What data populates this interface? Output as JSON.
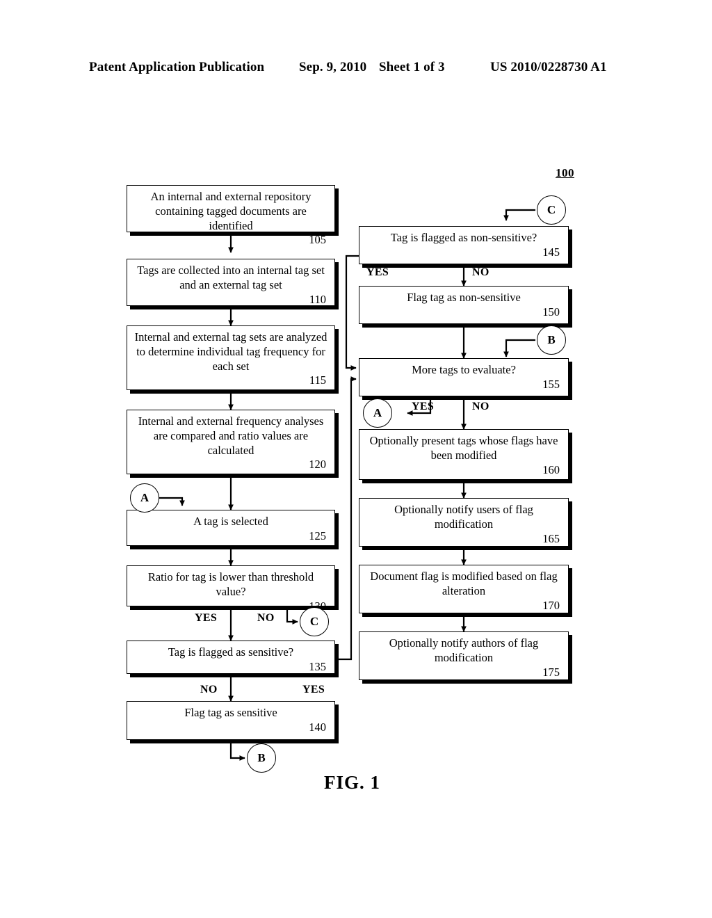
{
  "header": {
    "publication": "Patent Application Publication",
    "date": "Sep. 9, 2010",
    "sheet": "Sheet 1 of 3",
    "patent_number": "US 2010/0228730 A1"
  },
  "figure": {
    "reference_numeral": "100",
    "caption": "FIG. 1"
  },
  "nodes": [
    {
      "id": "105",
      "text": "An internal and external repository\ncontaining tagged documents are identified",
      "num": "105"
    },
    {
      "id": "110",
      "text": "Tags are collected into an internal tag set\nand an external tag set",
      "num": "110"
    },
    {
      "id": "115",
      "text": "Internal and external tag sets are analyzed\nto determine individual tag frequency for\neach set",
      "num": "115"
    },
    {
      "id": "120",
      "text": "Internal and external frequency analyses\nare compared and ratio values are\ncalculated",
      "num": "120"
    },
    {
      "id": "125",
      "text": "A tag is selected",
      "num": "125"
    },
    {
      "id": "130",
      "text": "Ratio for tag is lower than threshold value?",
      "num": "130"
    },
    {
      "id": "135",
      "text": "Tag is flagged as sensitive?",
      "num": "135"
    },
    {
      "id": "140",
      "text": "Flag tag as sensitive",
      "num": "140"
    },
    {
      "id": "145",
      "text": "Tag is flagged as non-sensitive?",
      "num": "145"
    },
    {
      "id": "150",
      "text": "Flag tag as non-sensitive",
      "num": "150"
    },
    {
      "id": "155",
      "text": "More tags to evaluate?",
      "num": "155"
    },
    {
      "id": "160",
      "text": "Optionally present tags whose flags have\nbeen modified",
      "num": "160"
    },
    {
      "id": "165",
      "text": "Optionally notify users of flag\nmodification",
      "num": "165"
    },
    {
      "id": "170",
      "text": "Document flag is modified based on flag\nalteration",
      "num": "170"
    },
    {
      "id": "175",
      "text": "Optionally notify authors of flag\nmodification",
      "num": "175"
    }
  ],
  "connectors": [
    {
      "id": "a-left",
      "label": "A"
    },
    {
      "id": "c-left",
      "label": "C"
    },
    {
      "id": "b-left",
      "label": "B"
    },
    {
      "id": "c-right",
      "label": "C"
    },
    {
      "id": "b-right",
      "label": "B"
    },
    {
      "id": "a-right",
      "label": "A"
    }
  ],
  "branch_labels": [
    {
      "id": "yes-130",
      "label": "YES"
    },
    {
      "id": "no-130",
      "label": "NO"
    },
    {
      "id": "no-135",
      "label": "NO"
    },
    {
      "id": "yes-135",
      "label": "YES"
    },
    {
      "id": "yes-145",
      "label": "YES"
    },
    {
      "id": "no-145",
      "label": "NO"
    },
    {
      "id": "yes-155",
      "label": "YES"
    },
    {
      "id": "no-155",
      "label": "NO"
    }
  ]
}
